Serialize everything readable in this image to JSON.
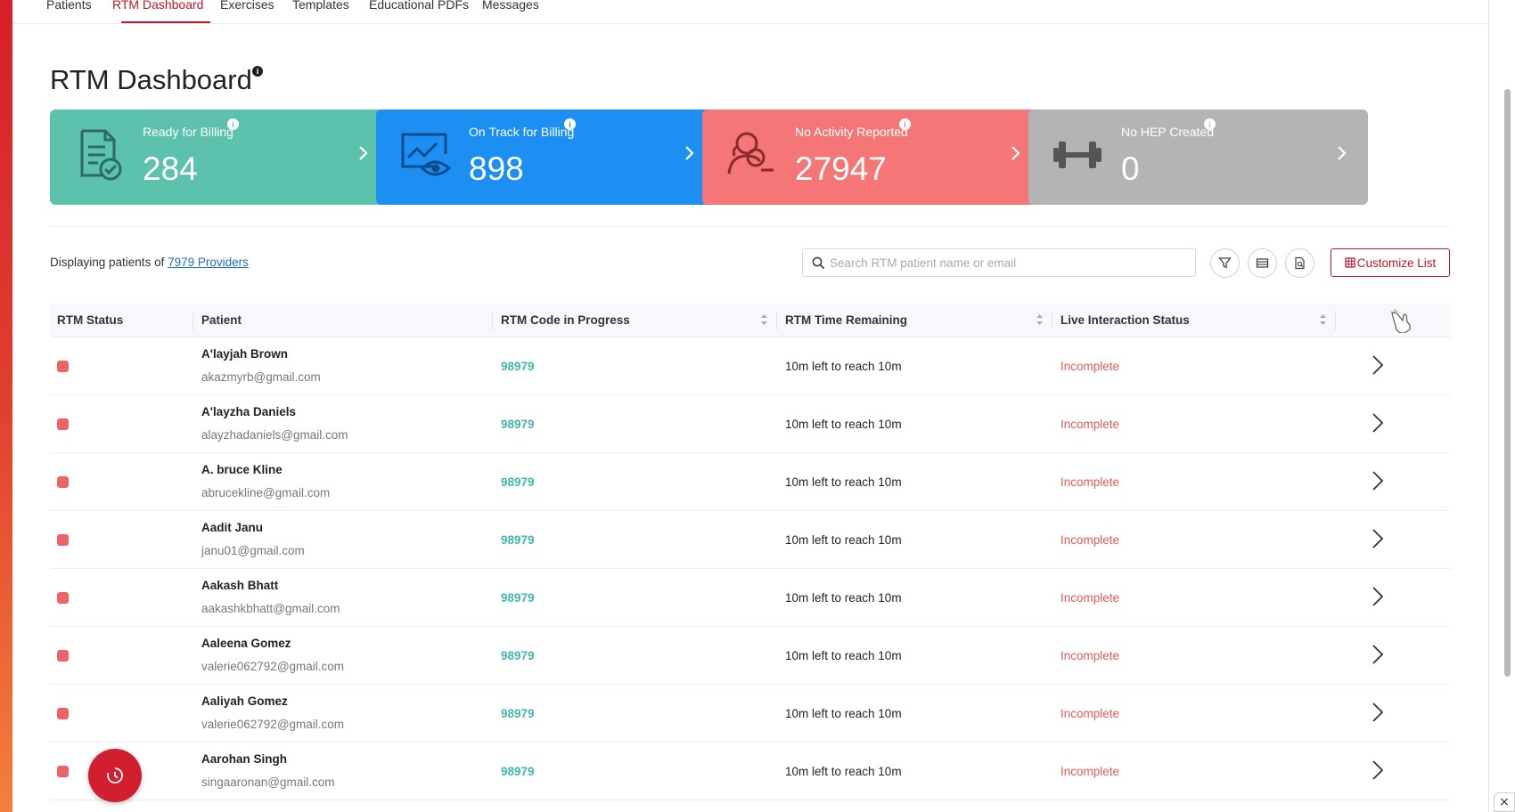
{
  "nav": {
    "tabs": [
      {
        "label": "Patients"
      },
      {
        "label": "RTM Dashboard"
      },
      {
        "label": "Exercises"
      },
      {
        "label": "Templates"
      },
      {
        "label": "Educational PDFs"
      },
      {
        "label": "Messages"
      }
    ],
    "active_tab": "RTM Dashboard"
  },
  "page": {
    "title": "RTM Dashboard",
    "info_icon": "info-icon"
  },
  "cards": [
    {
      "label": "Ready for Billing",
      "value": "284",
      "color": "#5cc1ad",
      "icon": "billing-check-icon"
    },
    {
      "label": "On Track for Billing",
      "value": "898",
      "color": "#1d8ff2",
      "icon": "monitor-eye-icon"
    },
    {
      "label": "No Activity Reported",
      "value": "27947",
      "color": "#f57676",
      "icon": "person-minus-icon"
    },
    {
      "label": "No HEP Created",
      "value": "0",
      "color": "#b4b4b4",
      "icon": "dumbbell-icon"
    }
  ],
  "toolbar": {
    "displaying_prefix": "Displaying patients of ",
    "providers_link": "7979 Providers",
    "search_placeholder": "Search RTM patient name or email",
    "search_value": "",
    "customize_label": "Customize List"
  },
  "table": {
    "columns": [
      "RTM Status",
      "Patient",
      "RTM Code in Progress",
      "RTM Time Remaining",
      "Live Interaction Status"
    ],
    "rows": [
      {
        "name": "A'layjah Brown",
        "email": "akazmyrb@gmail.com",
        "code": "98979",
        "time": "10m left to reach 10m",
        "live": "Incomplete"
      },
      {
        "name": "A'layzha Daniels",
        "email": "alayzhadaniels@gmail.com",
        "code": "98979",
        "time": "10m left to reach 10m",
        "live": "Incomplete"
      },
      {
        "name": "A. bruce Kline",
        "email": "abrucekline@gmail.com",
        "code": "98979",
        "time": "10m left to reach 10m",
        "live": "Incomplete"
      },
      {
        "name": "Aadit Janu",
        "email": "janu01@gmail.com",
        "code": "98979",
        "time": "10m left to reach 10m",
        "live": "Incomplete"
      },
      {
        "name": "Aakash Bhatt",
        "email": "aakashkbhatt@gmail.com",
        "code": "98979",
        "time": "10m left to reach 10m",
        "live": "Incomplete"
      },
      {
        "name": "Aaleena Gomez",
        "email": "valerie062792@gmail.com",
        "code": "98979",
        "time": "10m left to reach 10m",
        "live": "Incomplete"
      },
      {
        "name": "Aaliyah Gomez",
        "email": "valerie062792@gmail.com",
        "code": "98979",
        "time": "10m left to reach 10m",
        "live": "Incomplete"
      },
      {
        "name": "Aarohan Singh",
        "email": "singaaronan@gmail.com",
        "code": "98979",
        "time": "10m left to reach 10m",
        "live": "Incomplete"
      }
    ]
  },
  "colors": {
    "accent": "#c0182a",
    "status_incomplete": "#e25a5a",
    "code": "#3fb8ad",
    "status_dot": "#ec6465"
  }
}
